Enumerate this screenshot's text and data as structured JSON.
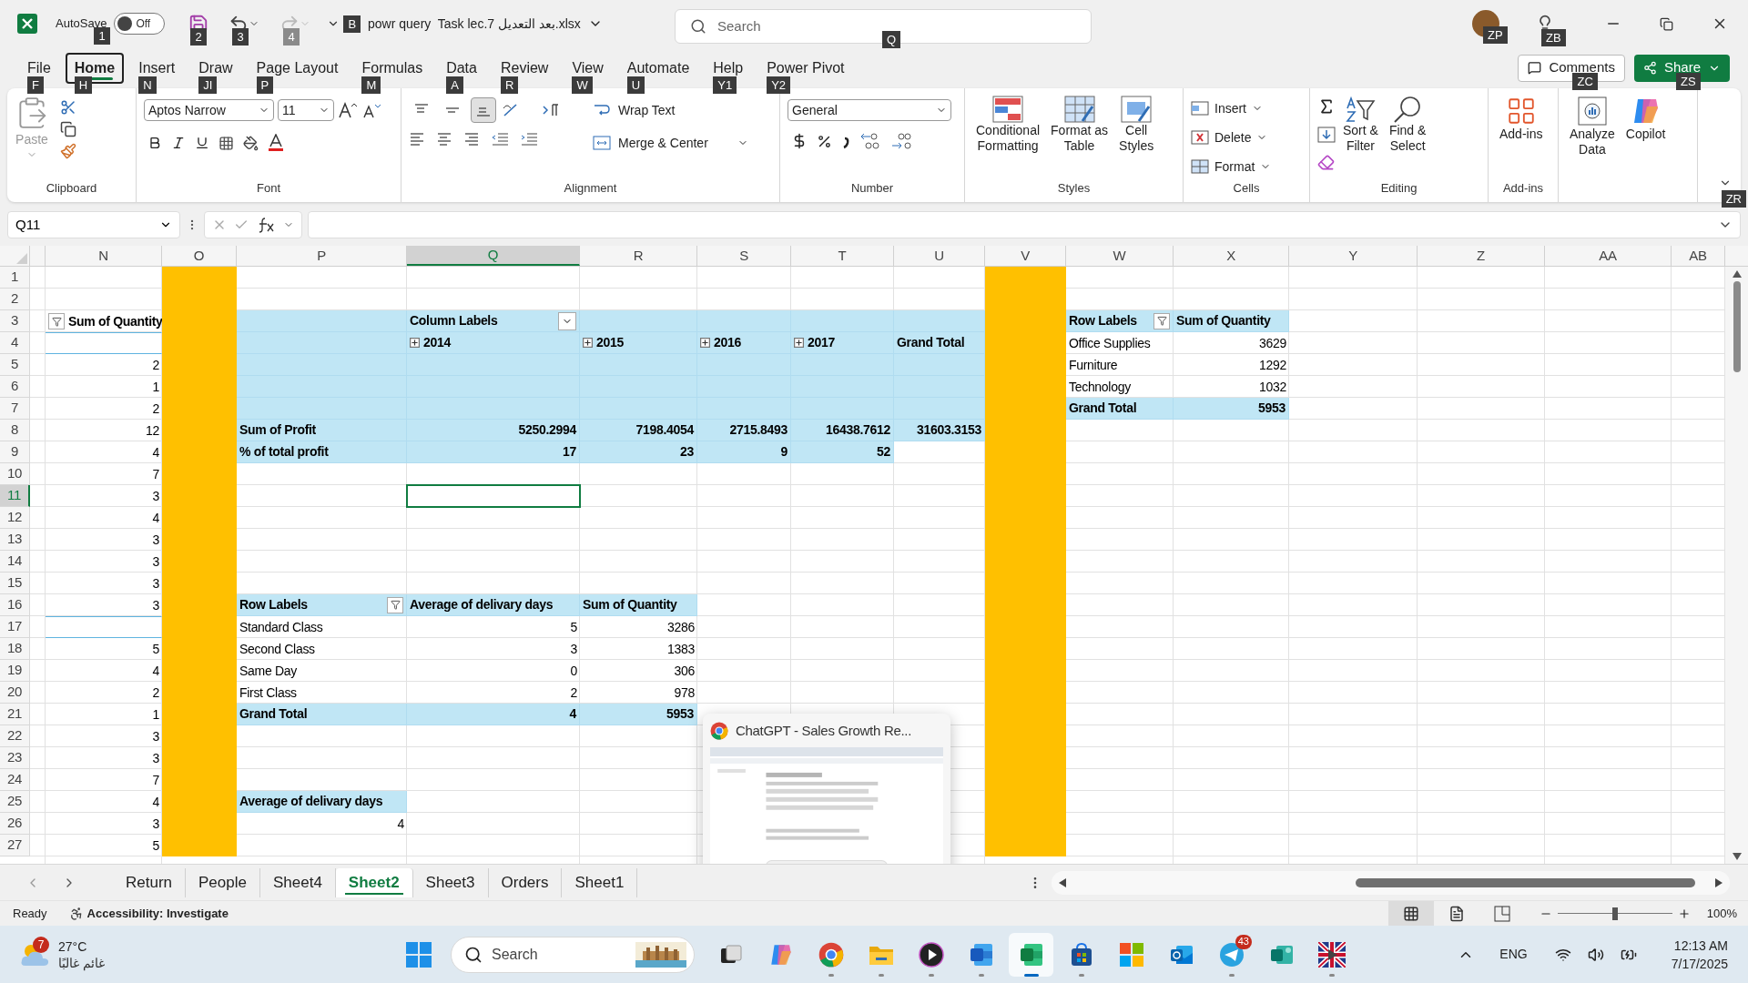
{
  "title_bar": {
    "autosave": {
      "label": "AutoSave",
      "state": "Off",
      "on": false,
      "keytip": "1"
    },
    "save_keytip": "2",
    "undo_keytip": "3",
    "redo": {
      "keytip": "4",
      "disabled": true
    },
    "customize_keytip": "B",
    "filename": "powr query  Task lec.7 بعد التعديل.xlsx",
    "search": {
      "placeholder": "Search",
      "keytip": "Q"
    },
    "account_keytip": "ZP",
    "ideas_keytip": "ZB"
  },
  "ribbon": {
    "tabs": [
      {
        "label": "File",
        "keytip": "F",
        "selected": false
      },
      {
        "label": "Home",
        "keytip": "H",
        "selected": true
      },
      {
        "label": "Insert",
        "keytip": "N",
        "selected": false
      },
      {
        "label": "Draw",
        "keytip": "JI",
        "selected": false
      },
      {
        "label": "Page Layout",
        "keytip": "P",
        "selected": false
      },
      {
        "label": "Formulas",
        "keytip": "M",
        "selected": false
      },
      {
        "label": "Data",
        "keytip": "A",
        "selected": false
      },
      {
        "label": "Review",
        "keytip": "R",
        "selected": false
      },
      {
        "label": "View",
        "keytip": "W",
        "selected": false
      },
      {
        "label": "Automate",
        "keytip": "U",
        "selected": false
      },
      {
        "label": "Help",
        "keytip": "Y1",
        "selected": false
      },
      {
        "label": "Power Pivot",
        "keytip": "Y2",
        "selected": false
      }
    ],
    "comments": {
      "label": "Comments",
      "keytip": "ZC"
    },
    "share": {
      "label": "Share",
      "keytip": "ZS"
    },
    "collapse_keytip": "ZR",
    "clipboard": {
      "label": "Clipboard",
      "paste": "Paste",
      "paste_disabled": true
    },
    "font": {
      "label": "Font",
      "name": "Aptos Narrow",
      "size": "11"
    },
    "alignment": {
      "label": "Alignment",
      "vertical": [
        {
          "selected": false
        },
        {
          "selected": false
        },
        {
          "selected": true
        }
      ],
      "wrap": "Wrap Text",
      "merge": "Merge & Center"
    },
    "number": {
      "label": "Number",
      "format": "General"
    },
    "styles": {
      "label": "Styles",
      "buttons": [
        {
          "kind": "conditional",
          "lines": [
            "Conditional",
            "Formatting"
          ]
        },
        {
          "kind": "table",
          "lines": [
            "Format as",
            "Table"
          ]
        },
        {
          "kind": "cellstyles",
          "lines": [
            "Cell",
            "Styles"
          ]
        }
      ]
    },
    "cells": {
      "label": "Cells",
      "buttons": [
        {
          "kind": "insert",
          "label": "Insert"
        },
        {
          "kind": "delete",
          "label": "Delete"
        },
        {
          "kind": "format",
          "label": "Format"
        }
      ]
    },
    "editing": {
      "label": "Editing",
      "buttons": [
        {
          "kind": "sort",
          "lines": [
            "Sort &",
            "Filter"
          ]
        },
        {
          "kind": "find",
          "lines": [
            "Find &",
            "Select"
          ]
        }
      ]
    },
    "addins": {
      "label": "Add-ins",
      "button": "Add-ins"
    },
    "analysis": {
      "buttons": [
        {
          "kind": "analyze",
          "lines": [
            "Analyze",
            "Data"
          ]
        },
        {
          "kind": "copilot",
          "lines": [
            "Copilot"
          ]
        }
      ]
    }
  },
  "formula_bar": {
    "name_box": "Q11"
  },
  "sheet": {
    "columns": [
      {
        "letter": "N",
        "selected": false
      },
      {
        "letter": "O",
        "selected": false,
        "color": "#ffc000"
      },
      {
        "letter": "P",
        "selected": false
      },
      {
        "letter": "Q",
        "selected": true
      },
      {
        "letter": "R",
        "selected": false
      },
      {
        "letter": "S",
        "selected": false
      },
      {
        "letter": "T",
        "selected": false
      },
      {
        "letter": "U",
        "selected": false
      },
      {
        "letter": "V",
        "selected": false,
        "color": "#ffc000"
      },
      {
        "letter": "W",
        "selected": false
      },
      {
        "letter": "X",
        "selected": false
      },
      {
        "letter": "Y",
        "selected": false
      },
      {
        "letter": "Z",
        "selected": false
      },
      {
        "letter": "AA",
        "selected": false
      },
      {
        "letter": "AB",
        "selected": false
      }
    ],
    "rows": [
      {
        "label": "1",
        "selected": false
      },
      {
        "label": "2",
        "selected": false
      },
      {
        "label": "3",
        "selected": false,
        "cells": [
          {
            "shaded": false,
            "text": "Sum of Quantity",
            "kind": "filter_label",
            "bold": true
          },
          {
            "shaded": true
          },
          {
            "shaded": true,
            "text": "Column Labels",
            "kind": "dropdown_label",
            "bold": true
          },
          {
            "shaded": true
          },
          {
            "shaded": true
          },
          {
            "shaded": true
          },
          {
            "shaded": true
          },
          {
            "shaded": true,
            "text": "Row Labels",
            "kind": "filter_label",
            "bold": true
          },
          {
            "shaded": true,
            "text": "Sum of Quantity",
            "kind": "text",
            "bold": true
          }
        ]
      },
      {
        "label": "4",
        "selected": false,
        "cells": [
          {
            "shaded": false
          },
          {
            "shaded": true
          },
          {
            "shaded": true,
            "text": "2014",
            "kind": "year",
            "bold": true,
            "expanded": false
          },
          {
            "shaded": true,
            "text": "2015",
            "kind": "year",
            "bold": true,
            "expanded": false
          },
          {
            "shaded": true,
            "text": "2016",
            "kind": "year",
            "bold": true,
            "expanded": false
          },
          {
            "shaded": true,
            "text": "2017",
            "kind": "year",
            "bold": true,
            "expanded": false
          },
          {
            "shaded": true,
            "text": "Grand Total",
            "kind": "text",
            "bold": true
          },
          {
            "shaded": false,
            "text": "Office Supplies",
            "kind": "text",
            "bold": false
          },
          {
            "shaded": false,
            "text": "3629",
            "kind": "number",
            "bold": false
          }
        ]
      },
      {
        "label": "5",
        "selected": false,
        "cells": [
          {
            "shaded": false,
            "text": "2",
            "kind": "number",
            "bold": false
          },
          {
            "shaded": true
          },
          {
            "shaded": true
          },
          {
            "shaded": true
          },
          {
            "shaded": true
          },
          {
            "shaded": true
          },
          {
            "shaded": true
          },
          {
            "shaded": false,
            "text": "Furniture",
            "kind": "text",
            "bold": false
          },
          {
            "shaded": false,
            "text": "1292",
            "kind": "number",
            "bold": false
          }
        ]
      },
      {
        "label": "6",
        "selected": false,
        "cells": [
          {
            "shaded": false,
            "text": "1",
            "kind": "number",
            "bold": false
          },
          {
            "shaded": true
          },
          {
            "shaded": true
          },
          {
            "shaded": true
          },
          {
            "shaded": true
          },
          {
            "shaded": true
          },
          {
            "shaded": true
          },
          {
            "shaded": false,
            "text": "Technology",
            "kind": "text",
            "bold": false
          },
          {
            "shaded": false,
            "text": "1032",
            "kind": "number",
            "bold": false
          }
        ]
      },
      {
        "label": "7",
        "selected": false,
        "cells": [
          {
            "shaded": false,
            "text": "2",
            "kind": "number",
            "bold": false
          },
          {
            "shaded": true
          },
          {
            "shaded": true
          },
          {
            "shaded": true
          },
          {
            "shaded": true
          },
          {
            "shaded": true
          },
          {
            "shaded": true
          },
          {
            "shaded": true,
            "text": "Grand Total",
            "kind": "text",
            "bold": true
          },
          {
            "shaded": true,
            "text": "5953",
            "kind": "number",
            "bold": true
          }
        ]
      },
      {
        "label": "8",
        "selected": false,
        "cells": [
          {
            "shaded": false,
            "text": "12",
            "kind": "number",
            "bold": false
          },
          {
            "shaded": true,
            "text": "Sum of Profit",
            "kind": "text",
            "bold": true
          },
          {
            "shaded": true,
            "text": "5250.2994",
            "kind": "number",
            "bold": true
          },
          {
            "shaded": true,
            "text": "7198.4054",
            "kind": "number",
            "bold": true
          },
          {
            "shaded": true,
            "text": "2715.8493",
            "kind": "number",
            "bold": true
          },
          {
            "shaded": true,
            "text": "16438.7612",
            "kind": "number",
            "bold": true
          },
          {
            "shaded": true,
            "text": "31603.3153",
            "kind": "number",
            "bold": true
          }
        ]
      },
      {
        "label": "9",
        "selected": false,
        "cells": [
          {
            "shaded": false,
            "text": "4",
            "kind": "number",
            "bold": false
          },
          {
            "shaded": true,
            "text": "% of total profit",
            "kind": "text",
            "bold": true
          },
          {
            "shaded": true,
            "text": "17",
            "kind": "number",
            "bold": true
          },
          {
            "shaded": true,
            "text": "23",
            "kind": "number",
            "bold": true
          },
          {
            "shaded": true,
            "text": "9",
            "kind": "number",
            "bold": true
          },
          {
            "shaded": true,
            "text": "52",
            "kind": "number",
            "bold": true
          }
        ]
      },
      {
        "label": "10",
        "selected": false,
        "cells": [
          {
            "shaded": false,
            "text": "7",
            "kind": "number",
            "bold": false
          }
        ]
      },
      {
        "label": "11",
        "selected": true,
        "cells": [
          {
            "shaded": false,
            "text": "3",
            "kind": "number",
            "bold": false
          }
        ]
      },
      {
        "label": "12",
        "selected": false,
        "cells": [
          {
            "shaded": false,
            "text": "4",
            "kind": "number",
            "bold": false
          }
        ]
      },
      {
        "label": "13",
        "selected": false,
        "cells": [
          {
            "shaded": false,
            "text": "3",
            "kind": "number",
            "bold": false
          }
        ]
      },
      {
        "label": "14",
        "selected": false,
        "cells": [
          {
            "shaded": false,
            "text": "3",
            "kind": "number",
            "bold": false
          }
        ]
      },
      {
        "label": "15",
        "selected": false,
        "cells": [
          {
            "shaded": false,
            "text": "3",
            "kind": "number",
            "bold": false
          }
        ]
      },
      {
        "label": "16",
        "selected": false,
        "cells": [
          {
            "shaded": false,
            "text": "3",
            "kind": "number",
            "bold": false
          },
          {
            "shaded": true,
            "text": "Row Labels",
            "kind": "filter_label",
            "bold": true
          },
          {
            "shaded": true,
            "text": "Average of delivary days",
            "kind": "text",
            "bold": true
          },
          {
            "shaded": true,
            "text": "Sum of Quantity",
            "kind": "text",
            "bold": true
          }
        ]
      },
      {
        "label": "17",
        "selected": false,
        "cells": [
          {
            "shaded": false
          },
          {
            "shaded": false,
            "text": "Standard Class",
            "kind": "text",
            "bold": false
          },
          {
            "shaded": false,
            "text": "5",
            "kind": "number",
            "bold": false
          },
          {
            "shaded": false,
            "text": "3286",
            "kind": "number",
            "bold": false
          }
        ]
      },
      {
        "label": "18",
        "selected": false,
        "cells": [
          {
            "shaded": false,
            "text": "5",
            "kind": "number",
            "bold": false
          },
          {
            "shaded": false,
            "text": "Second Class",
            "kind": "text",
            "bold": false
          },
          {
            "shaded": false,
            "text": "3",
            "kind": "number",
            "bold": false
          },
          {
            "shaded": false,
            "text": "1383",
            "kind": "number",
            "bold": false
          }
        ]
      },
      {
        "label": "19",
        "selected": false,
        "cells": [
          {
            "shaded": false,
            "text": "4",
            "kind": "number",
            "bold": false
          },
          {
            "shaded": false,
            "text": "Same Day",
            "kind": "text",
            "bold": false
          },
          {
            "shaded": false,
            "text": "0",
            "kind": "number",
            "bold": false
          },
          {
            "shaded": false,
            "text": "306",
            "kind": "number",
            "bold": false
          }
        ]
      },
      {
        "label": "20",
        "selected": false,
        "cells": [
          {
            "shaded": false,
            "text": "2",
            "kind": "number",
            "bold": false
          },
          {
            "shaded": false,
            "text": "First Class",
            "kind": "text",
            "bold": false
          },
          {
            "shaded": false,
            "text": "2",
            "kind": "number",
            "bold": false
          },
          {
            "shaded": false,
            "text": "978",
            "kind": "number",
            "bold": false
          }
        ]
      },
      {
        "label": "21",
        "selected": false,
        "cells": [
          {
            "shaded": false,
            "text": "1",
            "kind": "number",
            "bold": false
          },
          {
            "shaded": true,
            "text": "Grand Total",
            "kind": "text",
            "bold": true
          },
          {
            "shaded": true,
            "text": "4",
            "kind": "number",
            "bold": true
          },
          {
            "shaded": true,
            "text": "5953",
            "kind": "number",
            "bold": true
          }
        ]
      },
      {
        "label": "22",
        "selected": false,
        "cells": [
          {
            "shaded": false,
            "text": "3",
            "kind": "number",
            "bold": false
          }
        ]
      },
      {
        "label": "23",
        "selected": false,
        "cells": [
          {
            "shaded": false,
            "text": "3",
            "kind": "number",
            "bold": false
          }
        ]
      },
      {
        "label": "24",
        "selected": false,
        "cells": [
          {
            "shaded": false,
            "text": "7",
            "kind": "number",
            "bold": false
          }
        ]
      },
      {
        "label": "25",
        "selected": false,
        "cells": [
          {
            "shaded": false,
            "text": "4",
            "kind": "number",
            "bold": false
          },
          {
            "shaded": true,
            "text": "Average of delivary days",
            "kind": "text",
            "bold": true
          }
        ]
      },
      {
        "label": "26",
        "selected": false,
        "cells": [
          {
            "shaded": false,
            "text": "3",
            "kind": "number",
            "bold": false
          },
          {
            "shaded": false,
            "text": "4",
            "kind": "number",
            "bold": false
          }
        ]
      },
      {
        "label": "27",
        "selected": false,
        "cells": [
          {
            "shaded": false,
            "text": "5",
            "kind": "number",
            "bold": false
          }
        ]
      }
    ],
    "sheet_tabs": [
      {
        "label": "Return",
        "selected": false
      },
      {
        "label": "People",
        "selected": false
      },
      {
        "label": "Sheet4",
        "selected": false
      },
      {
        "label": "Sheet2",
        "selected": true
      },
      {
        "label": "Sheet3",
        "selected": false
      },
      {
        "label": "Orders",
        "selected": false
      },
      {
        "label": "Sheet1",
        "selected": false
      }
    ]
  },
  "status_bar": {
    "ready": "Ready",
    "accessibility": "Accessibility: Investigate",
    "views": [
      {
        "kind": "normal",
        "selected": true
      },
      {
        "kind": "layout",
        "selected": false
      },
      {
        "kind": "pagebreak",
        "selected": false
      }
    ],
    "zoom": {
      "level": 0.5,
      "reading": "100%"
    }
  },
  "preview": {
    "title": "ChatGPT - Sales Growth Re...",
    "kind": "picture"
  },
  "taskbar": {
    "weather": {
      "temperature": "27°C",
      "condition": "غائم غالبًا",
      "badge": "7"
    },
    "search": "Search",
    "apps": [
      {
        "kind": "taskview",
        "running": false,
        "active": false
      },
      {
        "kind": "copilot",
        "running": false,
        "active": false
      },
      {
        "kind": "chrome",
        "running": true,
        "active": false
      },
      {
        "kind": "folder",
        "running": true,
        "active": false
      },
      {
        "kind": "media",
        "running": true,
        "active": false
      },
      {
        "kind": "word",
        "running": true,
        "active": false
      },
      {
        "kind": "excel",
        "running": true,
        "active": true
      },
      {
        "kind": "store",
        "running": true,
        "active": false
      },
      {
        "kind": "windows",
        "running": false,
        "active": false
      },
      {
        "kind": "outlook",
        "running": false,
        "active": false
      },
      {
        "kind": "telegram",
        "running": true,
        "active": false,
        "badge": "43"
      },
      {
        "kind": "forms",
        "running": false,
        "active": false
      },
      {
        "kind": "flag",
        "running": true,
        "active": false
      }
    ],
    "language": "ENG",
    "time": "12:13 AM",
    "date": "7/17/2025"
  }
}
